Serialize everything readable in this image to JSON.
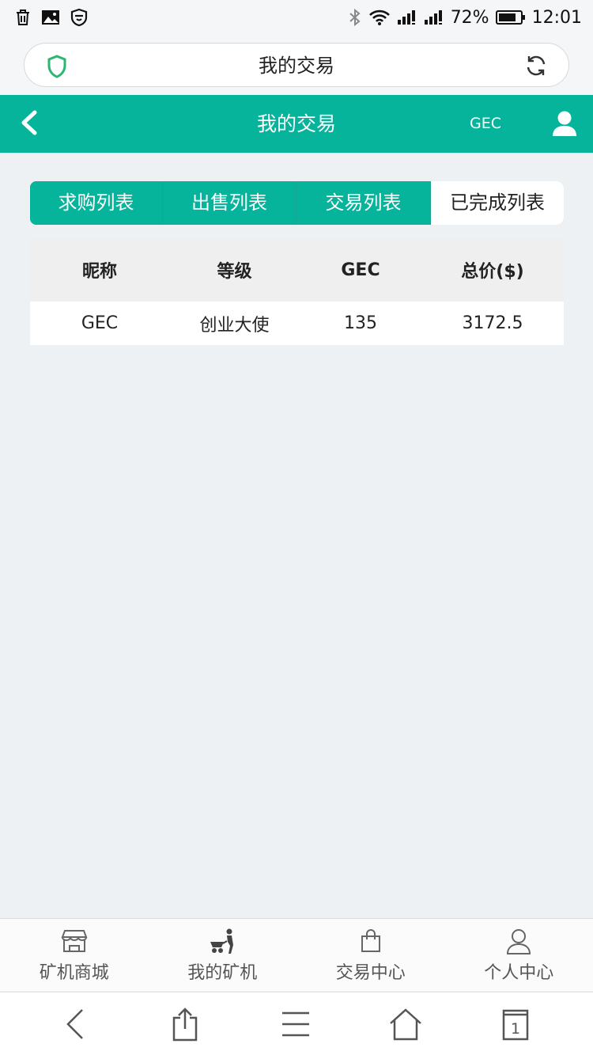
{
  "status_bar": {
    "battery_percent": "72%",
    "time": "12:01"
  },
  "browser": {
    "page_title": "我的交易",
    "tab_count": "1"
  },
  "header": {
    "title": "我的交易",
    "coin": "GEC"
  },
  "tabs": [
    {
      "label": "求购列表",
      "active": false
    },
    {
      "label": "出售列表",
      "active": false
    },
    {
      "label": "交易列表",
      "active": false
    },
    {
      "label": "已完成列表",
      "active": true
    }
  ],
  "table": {
    "headers": [
      "昵称",
      "等级",
      "GEC",
      "总价($)"
    ],
    "rows": [
      [
        "GEC",
        "创业大使",
        "135",
        "3172.5"
      ]
    ]
  },
  "bottom_nav": {
    "items": [
      {
        "label": "矿机商城",
        "icon": "shop-icon"
      },
      {
        "label": "我的矿机",
        "icon": "miner-cart-icon"
      },
      {
        "label": "交易中心",
        "icon": "shopping-bag-icon"
      },
      {
        "label": "个人中心",
        "icon": "person-icon"
      }
    ]
  },
  "colors": {
    "accent": "#06b39b",
    "page_bg": "#eef1f4",
    "shield": "#2bb673"
  }
}
